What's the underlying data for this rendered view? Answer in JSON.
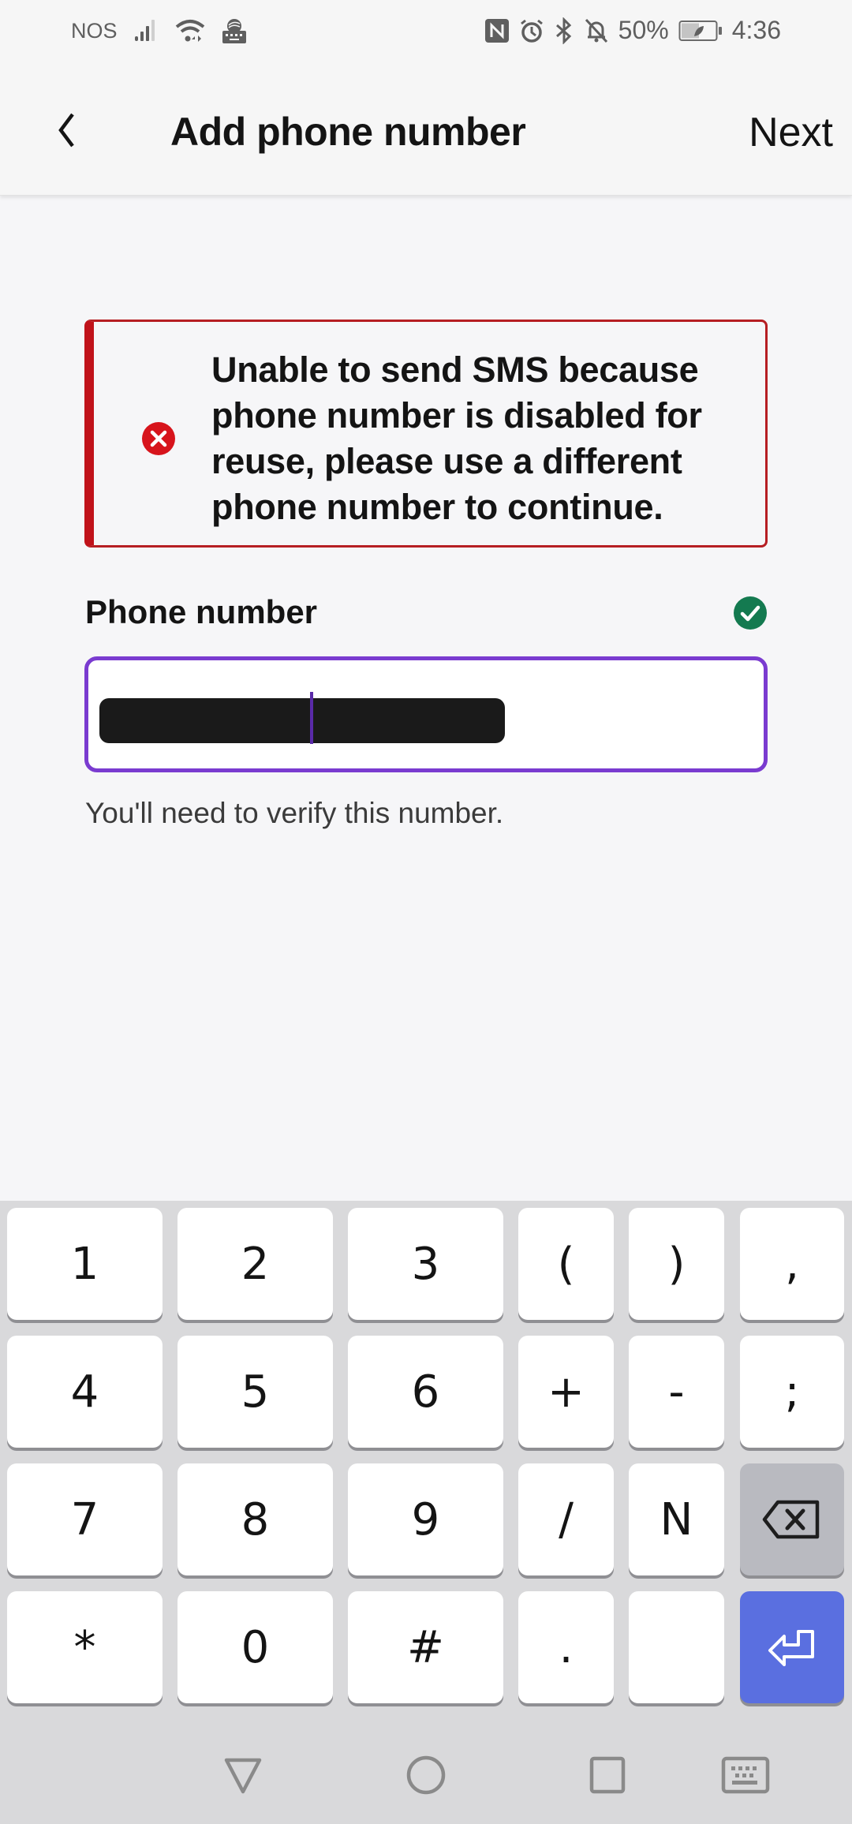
{
  "status_bar": {
    "carrier": "NOS",
    "battery_percent": "50%",
    "time": "4:36",
    "icons_left": [
      "signal-icon",
      "wifi-icon",
      "keyboard-app-icon"
    ],
    "icons_right": [
      "nfc-icon",
      "alarm-icon",
      "bluetooth-icon",
      "bell-off-icon",
      "battery-icon"
    ]
  },
  "app_bar": {
    "title": "Add phone number",
    "next_label": "Next",
    "back_icon": "chevron-left-icon"
  },
  "error": {
    "message": "Unable to send SMS because phone number is disabled for reuse, please use a different phone number to continue.",
    "icon": "error-circle-icon",
    "color": "#c0121a"
  },
  "phone_field": {
    "label": "Phone number",
    "value_redacted": true,
    "helper": "You'll need to verify this number.",
    "valid_icon": "check-circle-icon",
    "valid_color": "#147a50",
    "focus_color": "#7a3bd0"
  },
  "keyboard": {
    "rows": [
      [
        "1",
        "2",
        "3",
        "(",
        ")",
        ","
      ],
      [
        "4",
        "5",
        "6",
        "+",
        "-",
        ";"
      ],
      [
        "7",
        "8",
        "9",
        "/",
        "N",
        ""
      ],
      [
        "*",
        "0",
        "#",
        ".",
        "",
        ""
      ]
    ],
    "backspace_icon": "backspace-icon",
    "enter_icon": "enter-icon",
    "enter_color": "#5a6fe0"
  },
  "nav_bar": {
    "buttons": [
      "back-triangle-icon",
      "home-circle-icon",
      "recents-square-icon",
      "keyboard-toggle-icon"
    ]
  }
}
